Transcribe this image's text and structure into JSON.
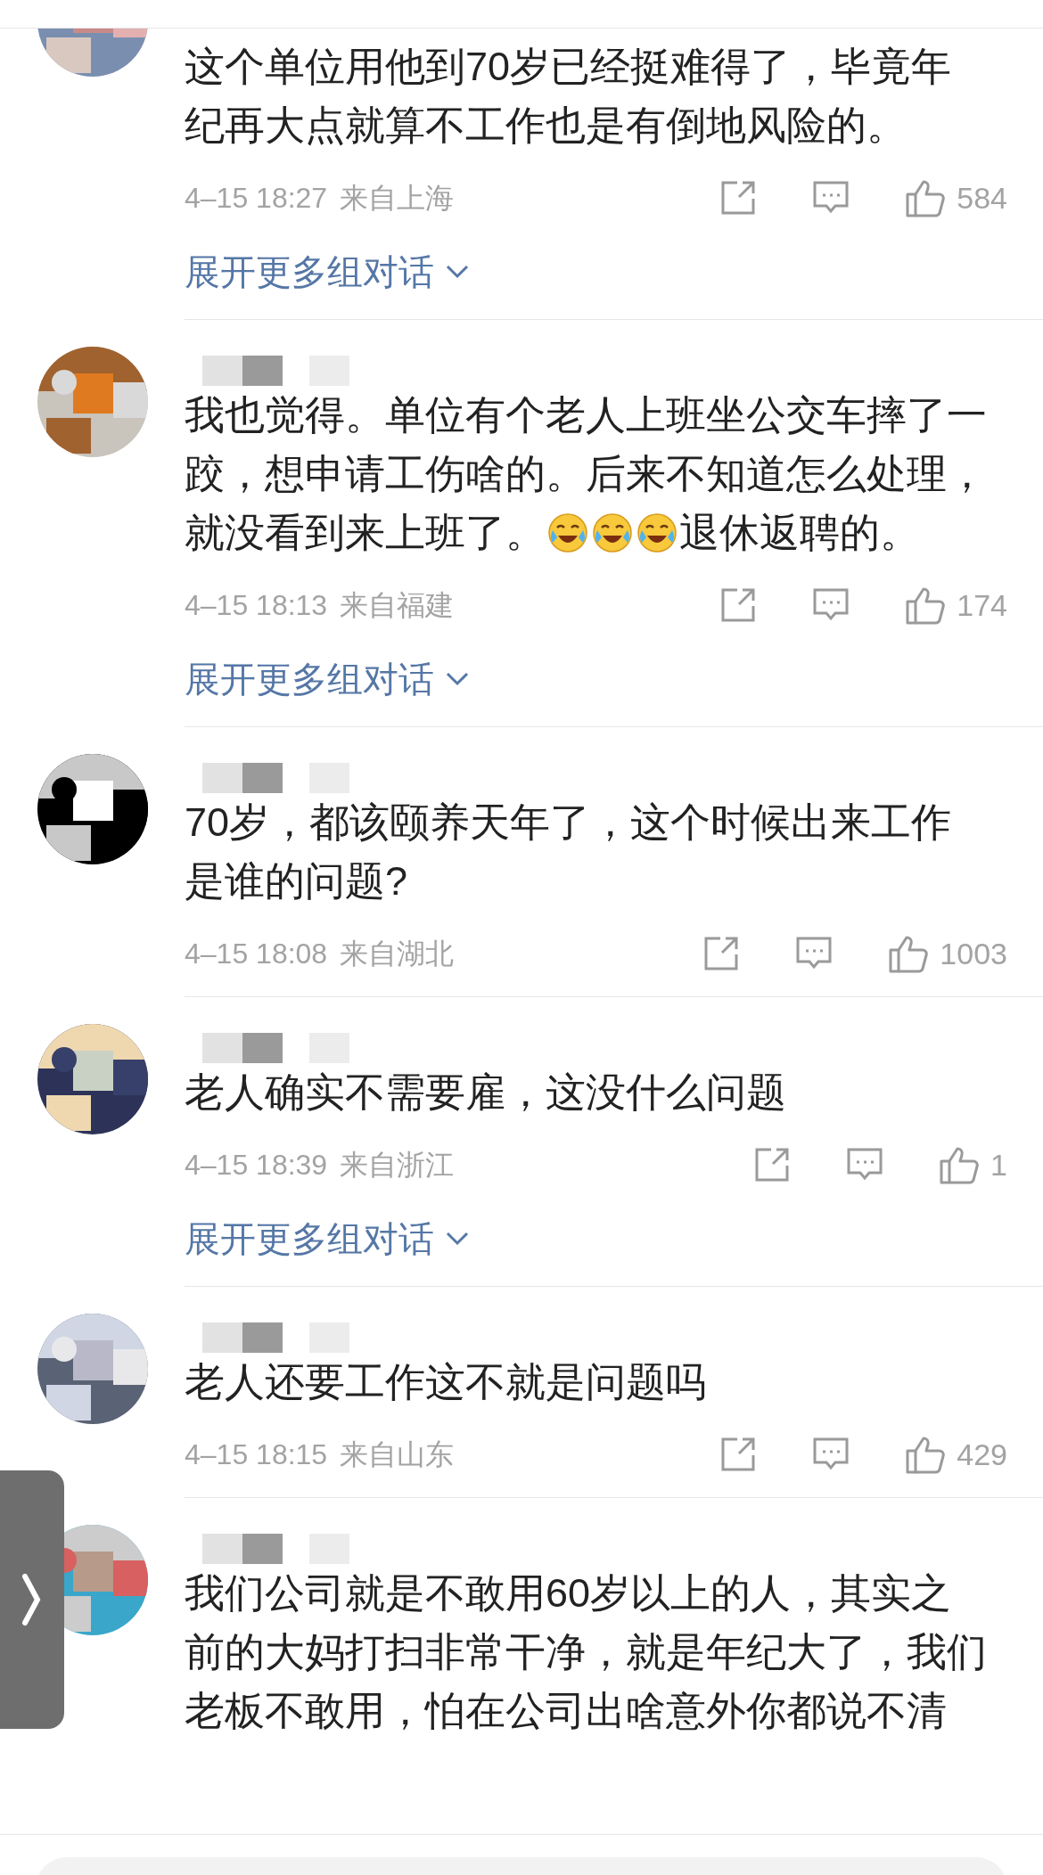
{
  "comments": [
    {
      "name_visible": false,
      "parts": [
        {
          "kind": "text",
          "text": "这个单位用他到70岁已经挺难得了，毕竟年纪再大点就算不工作也是有倒地风险的。"
        }
      ],
      "time": "4–15 18:27",
      "location": "来自上海",
      "likes": "584",
      "expand": "展开更多组对话"
    },
    {
      "name_visible": true,
      "parts": [
        {
          "kind": "text",
          "text": "我也觉得。单位有个老人上班坐公交车摔了一跤，想申请工伤啥的。后来不知道怎么处理，"
        },
        {
          "kind": "text",
          "text": "就没看到来上班了。"
        },
        {
          "kind": "emoji"
        },
        {
          "kind": "emoji"
        },
        {
          "kind": "emoji"
        },
        {
          "kind": "text",
          "text": "退休返聘的。"
        }
      ],
      "time": "4–15 18:13",
      "location": "来自福建",
      "likes": "174",
      "expand": "展开更多组对话"
    },
    {
      "name_visible": true,
      "parts": [
        {
          "kind": "text",
          "text": "70岁，都该颐养天年了，这个时候出来工作是谁的问题?"
        }
      ],
      "time": "4–15 18:08",
      "location": "来自湖北",
      "likes": "1003"
    },
    {
      "name_visible": true,
      "parts": [
        {
          "kind": "text",
          "text": "老人确实不需要雇，这没什么问题"
        }
      ],
      "time": "4–15 18:39",
      "location": "来自浙江",
      "likes": "1",
      "expand": "展开更多组对话"
    },
    {
      "name_visible": true,
      "parts": [
        {
          "kind": "text",
          "text": "老人还要工作这不就是问题吗"
        }
      ],
      "time": "4–15 18:15",
      "location": "来自山东",
      "likes": "429"
    },
    {
      "name_visible": true,
      "parts": [
        {
          "kind": "text",
          "text": "我们公司就是不敢用60岁以上的人，其实之前的大妈打扫非常干净，就是年纪大了，我们老板不敢用，怕在公司出啥意外你都说不清"
        }
      ]
    }
  ],
  "side_tab": {
    "shown": true
  },
  "input_bar": {
    "shown": true
  }
}
